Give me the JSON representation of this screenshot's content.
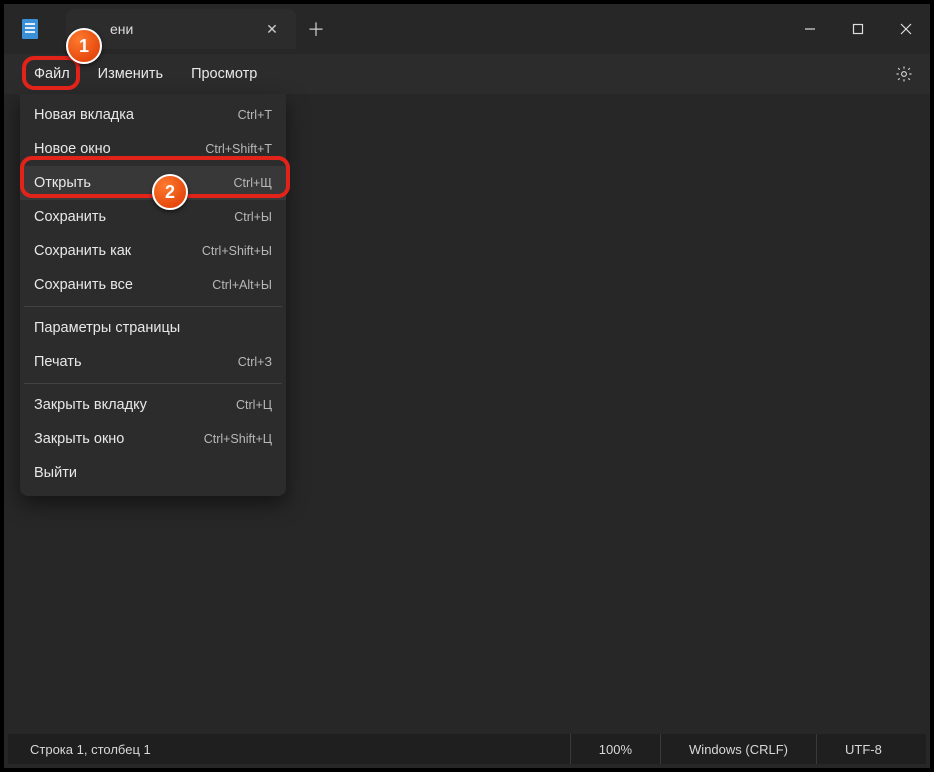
{
  "titlebar": {
    "tab_title": "ени",
    "close_glyph": "✕",
    "newtab_glyph": "＋"
  },
  "window_controls": {
    "minimize": "—",
    "maximize": "▢",
    "close": "✕"
  },
  "menubar": {
    "items": [
      "Файл",
      "Изменить",
      "Просмотр"
    ]
  },
  "dropdown": {
    "groups": [
      [
        {
          "label": "Новая вкладка",
          "shortcut": "Ctrl+T"
        },
        {
          "label": "Новое окно",
          "shortcut": "Ctrl+Shift+T"
        },
        {
          "label": "Открыть",
          "shortcut": "Ctrl+Щ",
          "highlight": true
        },
        {
          "label": "Сохранить",
          "shortcut": "Ctrl+Ы"
        },
        {
          "label": "Сохранить как",
          "shortcut": "Ctrl+Shift+Ы"
        },
        {
          "label": "Сохранить все",
          "shortcut": "Ctrl+Alt+Ы"
        }
      ],
      [
        {
          "label": "Параметры страницы",
          "shortcut": ""
        },
        {
          "label": "Печать",
          "shortcut": "Ctrl+З"
        }
      ],
      [
        {
          "label": "Закрыть вкладку",
          "shortcut": "Ctrl+Ц"
        },
        {
          "label": "Закрыть окно",
          "shortcut": "Ctrl+Shift+Ц"
        },
        {
          "label": "Выйти",
          "shortcut": ""
        }
      ]
    ]
  },
  "statusbar": {
    "position": "Строка 1, столбец 1",
    "zoom": "100%",
    "line_ending": "Windows (CRLF)",
    "encoding": "UTF-8"
  },
  "annotations": {
    "badge1": "1",
    "badge2": "2"
  }
}
